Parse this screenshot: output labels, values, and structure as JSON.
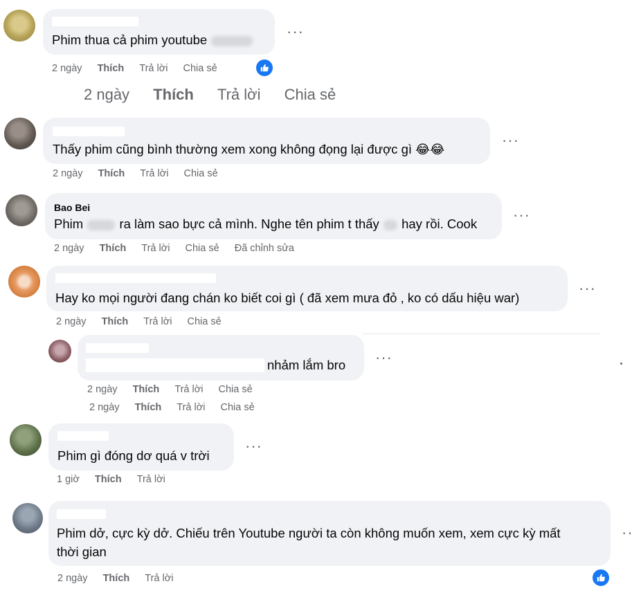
{
  "ui": {
    "more_glyph": "···"
  },
  "comments": [
    {
      "text_a": "Phim thua cả phim youtube",
      "actions": {
        "time": "2 ngày",
        "like": "Thích",
        "reply": "Trả lời",
        "share": "Chia sẻ"
      },
      "reaction": "like"
    },
    {
      "big_actions": {
        "time": "2 ngày",
        "like": "Thích",
        "reply": "Trả lời",
        "share": "Chia sẻ"
      }
    },
    {
      "text": "Thấy phim cũng bình thường xem xong không đọng lại được gì",
      "emoji": "😂😂",
      "actions": {
        "time": "2 ngày",
        "like": "Thích",
        "reply": "Trả lời",
        "share": "Chia sẻ"
      }
    },
    {
      "author": "Bao Bei",
      "text_a": "Phim",
      "text_b": "ra làm sao bực cả mình. Nghe tên phim t thấy",
      "text_c": "hay rồi. Cook",
      "actions": {
        "time": "2 ngày",
        "like": "Thích",
        "reply": "Trả lời",
        "share": "Chia sẻ",
        "edited": "Đã chỉnh sửa"
      }
    },
    {
      "text": "Hay ko mọi người đang chán ko biết coi gì ( đã xem mưa đỏ , ko có dấu hiệu war)",
      "actions": {
        "time": "2 ngày",
        "like": "Thích",
        "reply": "Trả lời",
        "share": "Chia sẻ"
      }
    },
    {
      "text_tail": "nhảm lắm bro",
      "actions": {
        "time": "2 ngày",
        "like": "Thích",
        "reply": "Trả lời",
        "share": "Chia sẻ"
      },
      "actions_dup": {
        "time": "2 ngày",
        "like": "Thích",
        "reply": "Trả lời",
        "share": "Chia sẻ"
      }
    },
    {
      "text": "Phim gì đóng dơ quá v trời",
      "actions": {
        "time": "1 giờ",
        "like": "Thích",
        "reply": "Trả lời"
      }
    },
    {
      "text_line1": "Phim dở, cực kỳ dở. Chiếu trên Youtube người ta còn không muốn xem, xem cực kỳ mất",
      "text_line2": "thời gian",
      "actions": {
        "time": "2 ngày",
        "like": "Thích",
        "reply": "Trả lời"
      },
      "reaction": "like"
    }
  ],
  "colors": {
    "bubble": "#f0f2f5",
    "meta": "#65676b",
    "like_badge": "#1877f2"
  }
}
